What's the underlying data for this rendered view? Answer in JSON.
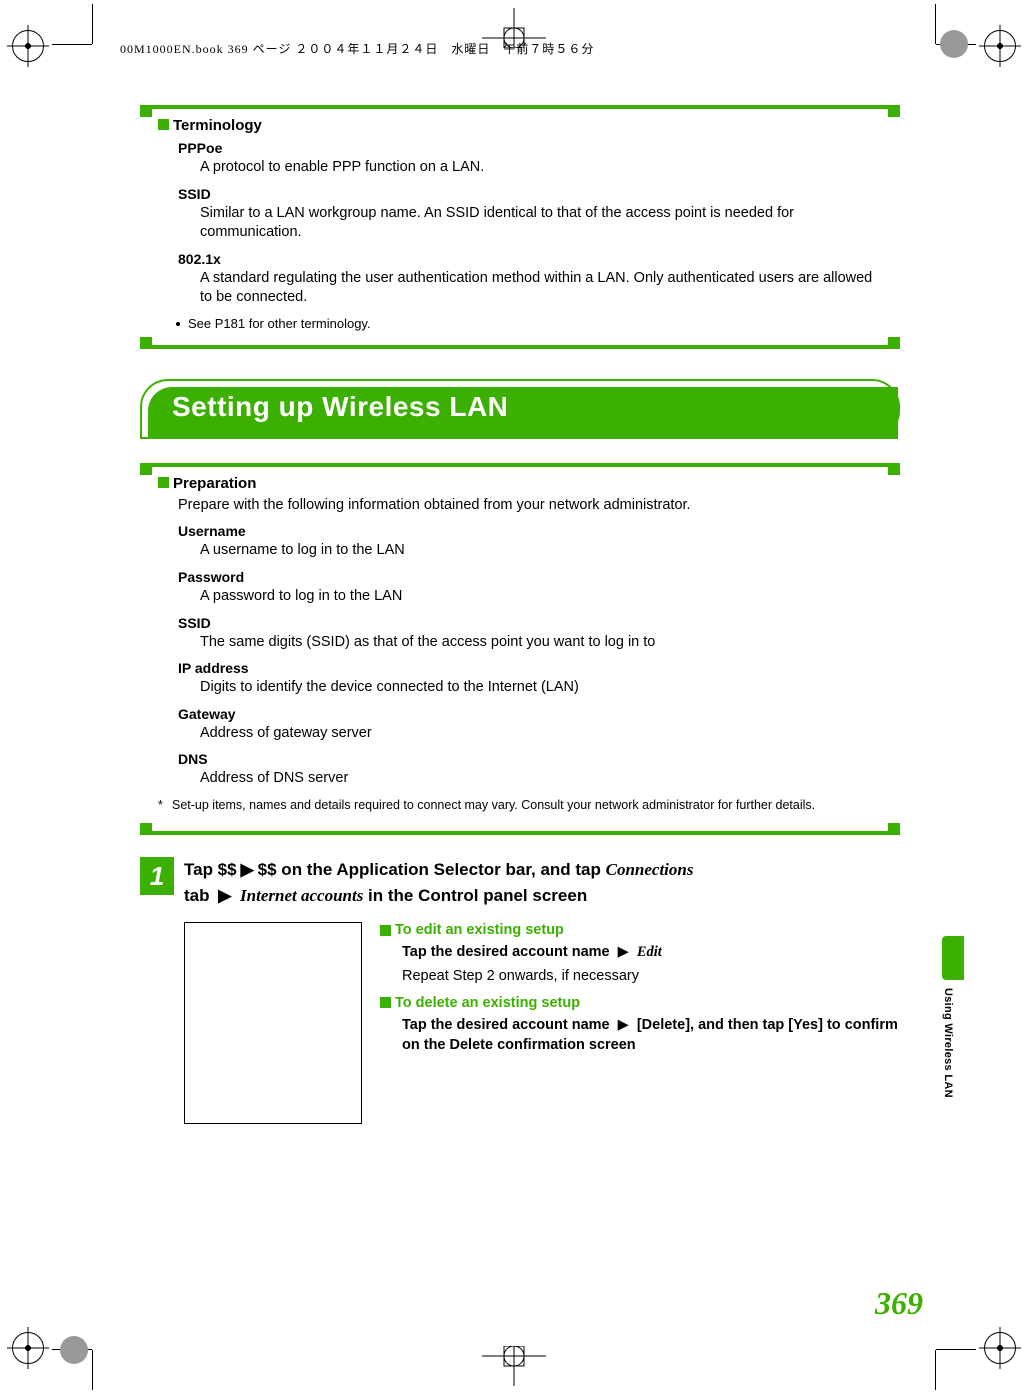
{
  "header_line": "00M1000EN.book  369 ページ  ２００４年１１月２４日　水曜日　午前７時５６分",
  "terminology": {
    "heading": "Terminology",
    "items": [
      {
        "name": "PPPoe",
        "desc": "A protocol to enable PPP function on a LAN."
      },
      {
        "name": "SSID",
        "desc": "Similar to a LAN workgroup name. An SSID identical to that of the access point is needed for communication."
      },
      {
        "name": "802.1x",
        "desc": "A standard regulating the user authentication method within a LAN. Only authenticated users are allowed to be connected."
      }
    ],
    "note": "See P181 for other terminology."
  },
  "banner": "Setting up Wireless LAN",
  "preparation": {
    "heading": "Preparation",
    "intro": "Prepare with the following information obtained from your network administrator.",
    "items": [
      {
        "name": "Username",
        "desc": "A username to log in to the LAN"
      },
      {
        "name": "Password",
        "desc": "A password to log in to the LAN"
      },
      {
        "name": "SSID",
        "desc": "The same digits (SSID) as that of the access point you want to log in to"
      },
      {
        "name": "IP address",
        "desc": "Digits to identify the device connected to the Internet (LAN)"
      },
      {
        "name": "Gateway",
        "desc": "Address of gateway server"
      },
      {
        "name": "DNS",
        "desc": "Address of DNS server"
      }
    ],
    "star_note": "Set-up items, names and details required to connect may vary. Consult your network administrator for further details."
  },
  "step1": {
    "num": "1",
    "text_pre": "Tap $$",
    "text_mid1": "$$ on the Application Selector bar, and tap ",
    "connections": "Connections",
    "text_tab": "tab ",
    "internet_accounts": "Internet accounts",
    "text_suffix": " in the Control panel screen",
    "edit_heading": "To edit an existing setup",
    "edit_line_bold": "Tap the desired account name ",
    "edit_word": "Edit",
    "edit_line2": "Repeat Step 2 onwards, if necessary",
    "delete_heading": "To delete an existing setup",
    "delete_line": "Tap the desired account name ",
    "delete_after": " [Delete], and then tap [Yes] to confirm on the Delete confirmation screen"
  },
  "side_label": "Using Wireless LAN",
  "page_number": "369"
}
